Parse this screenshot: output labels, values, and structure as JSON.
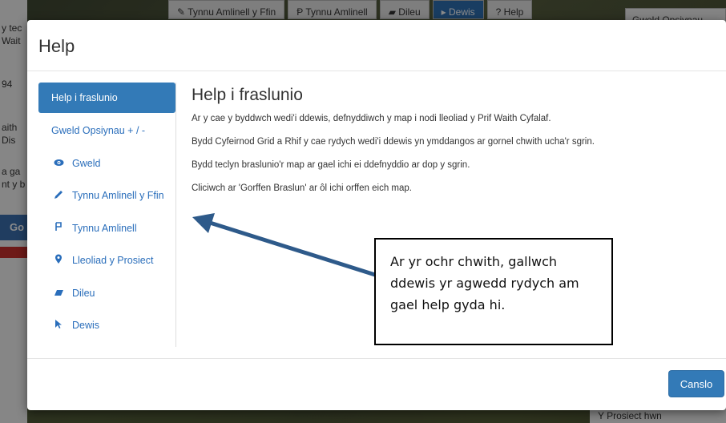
{
  "background": {
    "left_panel_lines": [
      "y tec",
      "Wait",
      "94",
      "aith",
      "Dis",
      "a ga",
      "nt y b"
    ],
    "go_button": "Go",
    "toolbar": [
      {
        "label": "✎ Tynnu Amlinell y Ffin",
        "active": false
      },
      {
        "label": "Ᵽ Tynnu Amlinell",
        "active": false
      },
      {
        "label": "▰ Dileu",
        "active": false
      },
      {
        "label": "▸ Dewis",
        "active": true
      },
      {
        "label": "? Help",
        "active": false
      }
    ],
    "right_box": "Gweld Opsiynau",
    "bottom_right": "Y Prosiect hwn"
  },
  "modal": {
    "title": "Help",
    "nav": [
      {
        "label": "Help i fraslunio",
        "icon": "",
        "active": true
      },
      {
        "label": "Gweld Opsiynau + / -",
        "icon": "",
        "active": false
      },
      {
        "label": "Gweld",
        "icon": "eye-icon",
        "active": false
      },
      {
        "label": "Tynnu Amlinell y Ffin",
        "icon": "pencil-icon",
        "active": false
      },
      {
        "label": "Tynnu Amlinell",
        "icon": "polyline-icon",
        "active": false
      },
      {
        "label": "Lleoliad y Prosiect",
        "icon": "map-marker-icon",
        "active": false
      },
      {
        "label": "Dileu",
        "icon": "eraser-icon",
        "active": false
      },
      {
        "label": "Dewis",
        "icon": "cursor-icon",
        "active": false
      }
    ],
    "content": {
      "title": "Help i fraslunio",
      "lines": [
        "Ar y cae y byddwch wedi'i ddewis, defnyddiwch y map i nodi lleoliad y Prif Waith Cyfalaf.",
        "Bydd Cyfeirnod Grid a Rhif y cae rydych wedi'i ddewis yn ymddangos ar gornel chwith ucha'r sgrin.",
        "Bydd teclyn braslunio'r map ar gael ichi ei ddefnyddio ar dop y sgrin.",
        "Cliciwch ar 'Gorffen Braslun' ar ôl ichi orffen eich map."
      ]
    },
    "cancel_label": "Canslo"
  },
  "annotation": {
    "text": "Ar yr ochr chwith, gallwch ddewis yr agwedd rydych am gael help gyda hi.",
    "arrow_color": "#2e5a8a"
  }
}
